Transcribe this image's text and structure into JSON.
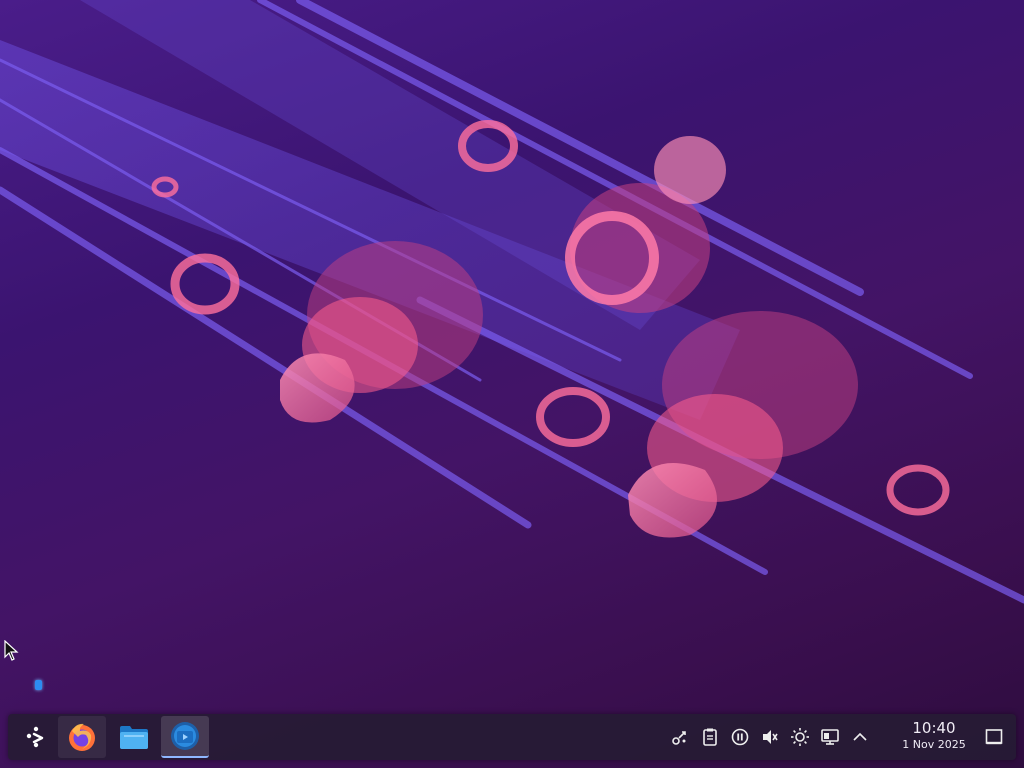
{
  "desktop": {
    "wallpaper": "abstract purple wallpaper with pink translucent ribbons",
    "colors": {
      "accent": "#2d8cf0",
      "panel": "#261b34",
      "ribbon": "#ff6f9c"
    }
  },
  "taskbar": {
    "launcher_icon": "application-launcher-icon",
    "tasks": [
      {
        "name": "firefox",
        "icon": "firefox-icon"
      },
      {
        "name": "files",
        "icon": "folder-icon"
      },
      {
        "name": "discover",
        "icon": "discover-icon"
      }
    ],
    "tray_icons": [
      "network-icon",
      "clipboard-icon",
      "media-pause-icon",
      "volume-muted-icon",
      "brightness-icon",
      "display-icon",
      "chevron-up-icon"
    ],
    "clock": {
      "time": "10:40",
      "date": "1 Nov 2025"
    },
    "show_desktop_icon": "show-desktop-icon"
  }
}
